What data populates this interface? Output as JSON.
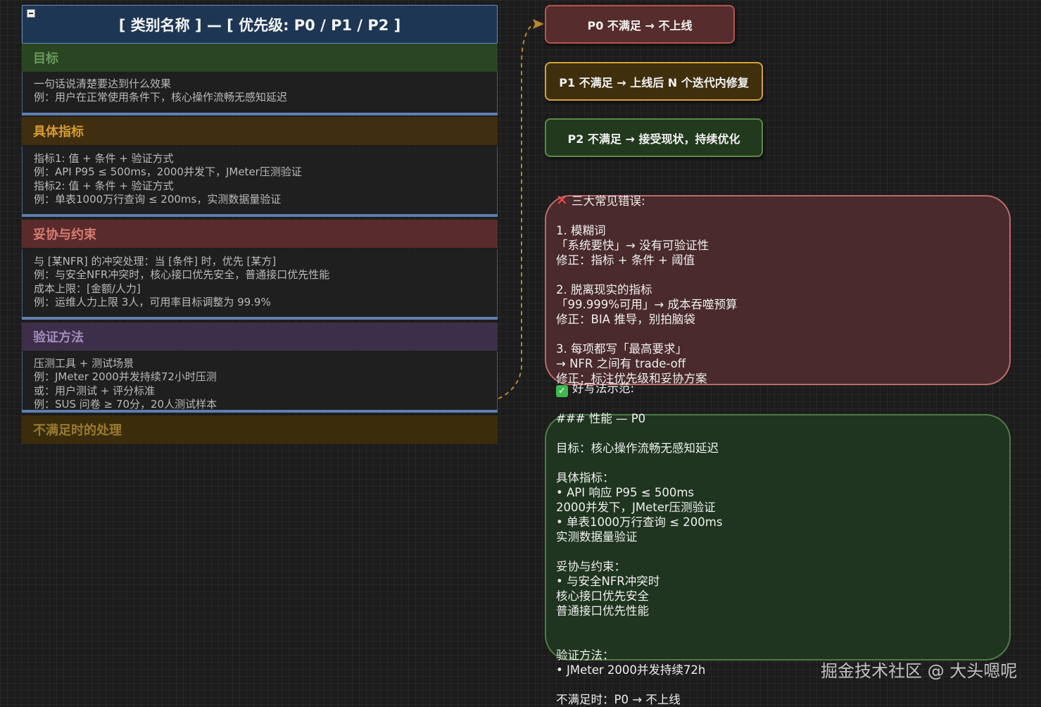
{
  "card": {
    "title": "[ 类别名称 ] — [ 优先级: P0 / P1 / P2 ]",
    "sections": [
      {
        "header": "目标",
        "lines": [
          "一句话说清楚要达到什么效果",
          "例：用户在正常使用条件下，核心操作流畅无感知延迟"
        ]
      },
      {
        "header": "具体指标",
        "lines": [
          "指标1: 值 + 条件 + 验证方式",
          "例：API P95 ≤ 500ms，2000并发下，JMeter压测验证",
          "指标2: 值 + 条件 + 验证方式",
          "例：单表1000万行查询 ≤ 200ms，实测数据量验证"
        ]
      },
      {
        "header": "妥协与约束",
        "lines": [
          "与 [某NFR] 的冲突处理：当 [条件] 时，优先 [某方]",
          "例：与安全NFR冲突时，核心接口优先安全，普通接口优先性能",
          "成本上限：[金额/人力]",
          "例：运维人力上限 3人，可用率目标调整为 99.9%"
        ]
      },
      {
        "header": "验证方法",
        "lines": [
          "压测工具 + 测试场景",
          "例：JMeter 2000并发持续72小时压测",
          "或：用户测试 + 评分标准",
          "例：SUS 问卷 ≥ 70分，20人测试样本"
        ]
      },
      {
        "header": "不满足时的处理",
        "lines": []
      }
    ]
  },
  "priorities": {
    "p0": "P0 不满足 → 不上线",
    "p1": "P1 不满足 → 上线后 N 个迭代内修复",
    "p2": "P2 不满足 → 接受现状，持续优化"
  },
  "errors": {
    "title": "三大常见错误:",
    "lines": [
      "1. 模糊词",
      "「系统要快」→ 没有可验证性",
      "修正：指标 + 条件 + 阈值",
      "",
      "2. 脱离现实的指标",
      "「99.999%可用」→ 成本吞噬预算",
      "修正：BIA 推导，别拍脑袋",
      "",
      "3. 每项都写「最高要求」",
      "→ NFR 之间有 trade-off",
      "修正：标注优先级和妥协方案"
    ]
  },
  "example": {
    "title": "好写法示范:",
    "lines": [
      "### 性能 — P0",
      "",
      "目标：核心操作流畅无感知延迟",
      "",
      "具体指标：",
      "• API 响应 P95 ≤ 500ms",
      "2000并发下，JMeter压测验证",
      "• 单表1000万行查询 ≤ 200ms",
      "实测数据量验证",
      "",
      "妥协与约束：",
      "• 与安全NFR冲突时",
      "核心接口优先安全",
      "普通接口优先性能",
      "",
      "",
      "验证方法：",
      "• JMeter 2000并发持续72h",
      "",
      "不满足时：P0 → 不上线"
    ]
  },
  "watermark": "掘金技术社区 @ 大头嗯呢",
  "colors": {
    "goal": "#2a4522",
    "metrics": "#3f2e0f",
    "tradeoff": "#5a2b2b",
    "verify": "#3d2f4a",
    "unmet": "#3b2d0c",
    "goal_text": "#6a9a5c",
    "metrics_text": "#d59b35",
    "tradeoff_text": "#d77c73",
    "verify_text": "#a68bbc",
    "unmet_text": "#9a7a30"
  }
}
